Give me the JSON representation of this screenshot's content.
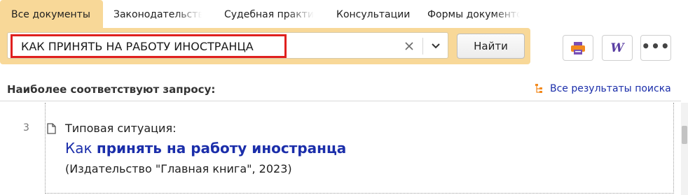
{
  "tabs": [
    {
      "label": "Все документы",
      "active": true
    },
    {
      "label": "Законодательство"
    },
    {
      "label": "Судебная практика"
    },
    {
      "label": "Консультации"
    },
    {
      "label": "Формы документов"
    }
  ],
  "search": {
    "query": "КАК ПРИНЯТЬ НА РАБОТУ ИНОСТРАНЦА",
    "find_label": "Найти"
  },
  "toolbar": {
    "icons": [
      "print-icon",
      "word-icon",
      "more-icon"
    ],
    "word_glyph": "W",
    "more_glyph": "•••"
  },
  "results": {
    "heading": "Наиболее соответствуют запросу:",
    "all_results_label": "Все результаты поиска",
    "items": [
      {
        "number": "3",
        "type": "Типовая ситуация:",
        "title_prefix": "Как ",
        "title_bold": "принять на работу иностранца",
        "source": "(Издательство \"Главная книга\", 2023)"
      }
    ]
  },
  "colors": {
    "panel": "#f8d898",
    "highlight_border": "#e0201e",
    "link": "#1b2eaa",
    "accent_orange": "#f28a1e"
  }
}
